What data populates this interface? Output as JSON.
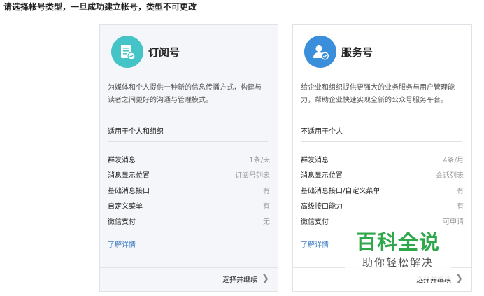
{
  "header": {
    "title": "请选择帐号类型，一旦成功建立帐号，类型不可更改"
  },
  "subscription": {
    "icon": "document-check-icon",
    "title": "订阅号",
    "description": "为媒体和个人提供一种新的信息传播方式，构建与读者之间更好的沟通与管理模式。",
    "suitability": "适用于个人和组织",
    "rows": [
      {
        "label": "群发消息",
        "value": "1条/天"
      },
      {
        "label": "消息显示位置",
        "value": "订阅号列表"
      },
      {
        "label": "基础消息接口",
        "value": "有"
      },
      {
        "label": "自定义菜单",
        "value": "有"
      },
      {
        "label": "微信支付",
        "value": "无"
      }
    ],
    "more": "了解详情",
    "action": "选择并继续"
  },
  "service": {
    "icon": "user-check-icon",
    "title": "服务号",
    "description": "给企业和组织提供更强大的业务服务与用户管理能力，帮助企业快速实现全新的公众号服务平台。",
    "suitability": "不适用于个人",
    "rows": [
      {
        "label": "群发消息",
        "value": "4条/月"
      },
      {
        "label": "消息显示位置",
        "value": "会话列表"
      },
      {
        "label": "基础消息接口/自定义菜单",
        "value": "有"
      },
      {
        "label": "高级接口能力",
        "value": "有"
      },
      {
        "label": "微信支付",
        "value": "可申请"
      }
    ],
    "more": "了解详情",
    "action": "选择并继续"
  },
  "watermark": {
    "brand": "百科全说",
    "slogan": "助你轻松解决"
  },
  "colors": {
    "teal": "#45c4c7",
    "blue": "#3b8fda",
    "link": "#3a79c6",
    "watermark_green": "#2fa84b"
  }
}
